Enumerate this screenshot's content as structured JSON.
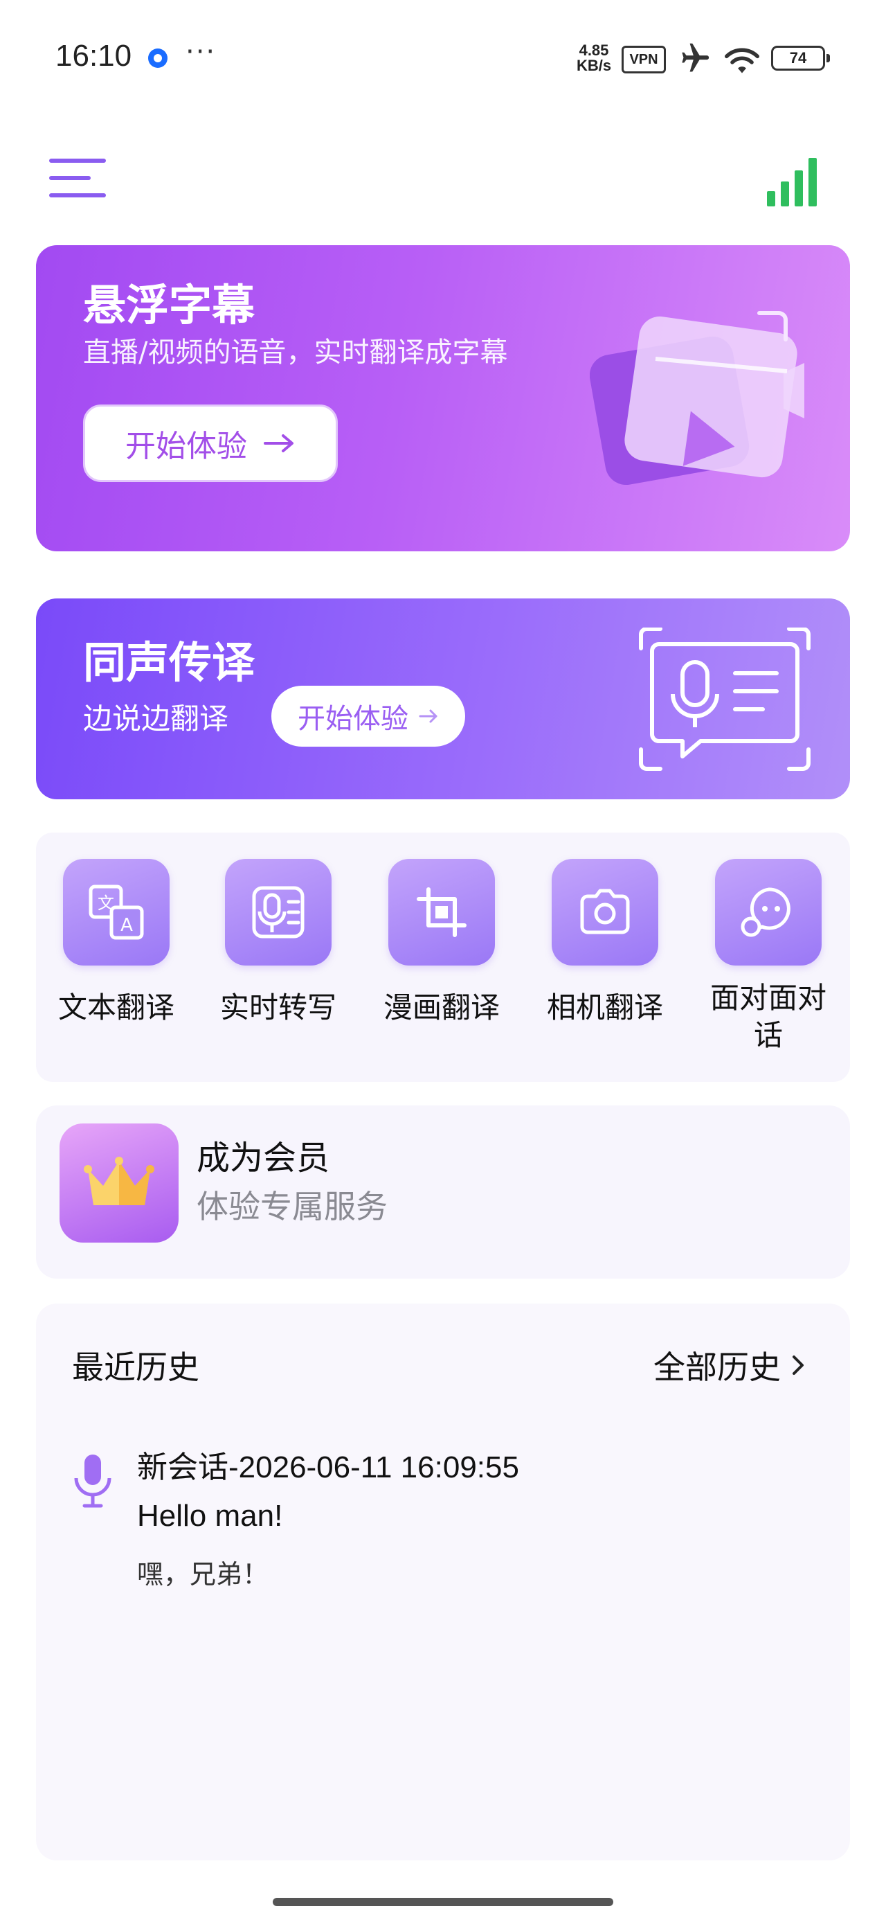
{
  "status_bar": {
    "time": "16:10",
    "network_speed": "4.85\nKB/s",
    "network_speed_value": "4.85",
    "network_speed_unit": "KB/s",
    "vpn_label": "VPN",
    "battery_level": "74",
    "icons": [
      "app-notification-icon",
      "more-dots-icon",
      "vpn-icon",
      "airplane-icon",
      "wifi-icon",
      "battery-icon"
    ]
  },
  "header": {
    "icons": [
      "menu-icon",
      "signal-strength-icon"
    ],
    "accent_color": "#2fbe5e"
  },
  "banner_subtitles": {
    "title": "悬浮字幕",
    "subtitle": "直播/视频的语音，实时翻译成字幕",
    "button_label": "开始体验",
    "button_arrow": "→",
    "gradient": [
      "#a24af2",
      "#d98cf9"
    ]
  },
  "banner_interpretation": {
    "title": "同声传译",
    "subtitle": "边说边翻译",
    "button_label": "开始体验",
    "button_arrow": "→",
    "gradient": [
      "#7a4af9",
      "#b18ff9"
    ]
  },
  "features": [
    {
      "label": "文本翻译",
      "icon": "text-translate-icon"
    },
    {
      "label": "实时转写",
      "icon": "voice-transcribe-icon"
    },
    {
      "label": "漫画翻译",
      "icon": "crop-icon"
    },
    {
      "label": "相机翻译",
      "icon": "camera-icon"
    },
    {
      "label": "面对面对话",
      "icon": "chat-bubbles-icon"
    }
  ],
  "membership": {
    "title": "成为会员",
    "subtitle": "体验专属服务",
    "icon": "crown-icon"
  },
  "history": {
    "title": "最近历史",
    "all_label": "全部历史",
    "items": [
      {
        "icon": "microphone-icon",
        "title": "新会话-2026-06-11  16:09:55",
        "source_text": "Hello man!",
        "translated_text": "嘿，兄弟！"
      }
    ]
  }
}
